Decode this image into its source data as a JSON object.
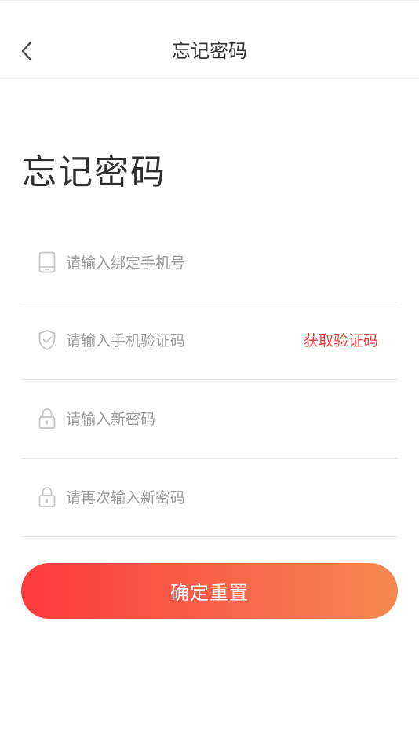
{
  "nav": {
    "back_icon": "chevron-left-icon",
    "title": "忘记密码"
  },
  "heading": "忘记密码",
  "form": {
    "phone": {
      "icon": "phone-icon",
      "placeholder": "请输入绑定手机号",
      "value": ""
    },
    "code": {
      "icon": "shield-icon",
      "placeholder": "请输入手机验证码",
      "value": "",
      "get_code_label": "获取验证码"
    },
    "new_password": {
      "icon": "lock-icon",
      "placeholder": "请输入新密码",
      "value": ""
    },
    "confirm_password": {
      "icon": "lock-icon",
      "placeholder": "请再次输入新密码",
      "value": ""
    }
  },
  "submit_label": "确定重置",
  "colors": {
    "accent": "#ee3a3a",
    "gradient_start": "#fd3a3d",
    "gradient_end": "#f5894f",
    "placeholder": "#999999",
    "divider": "#e6e6e6"
  }
}
